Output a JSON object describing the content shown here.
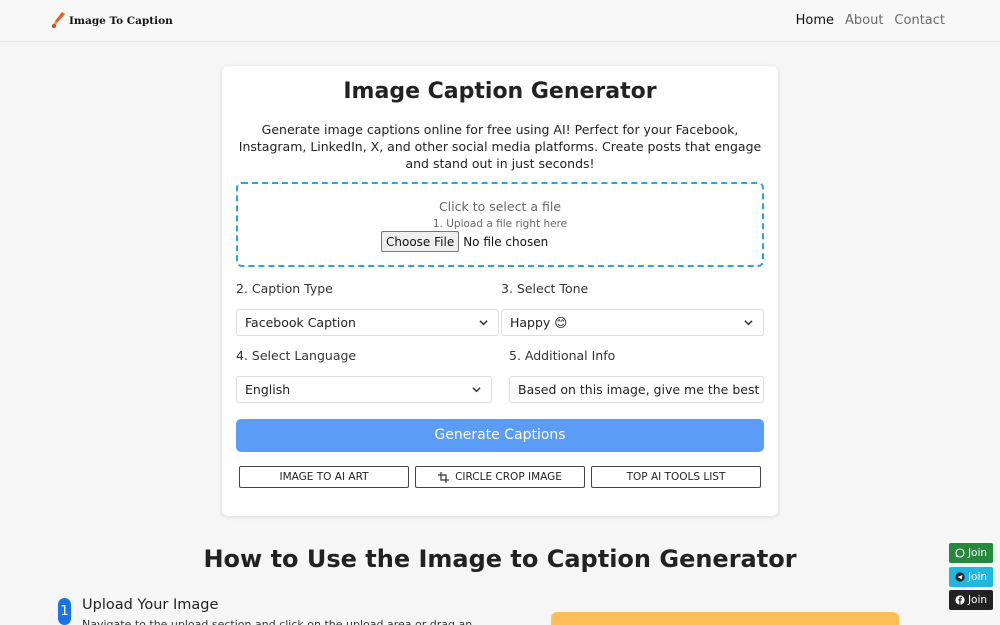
{
  "header": {
    "brand": "Image To Caption",
    "nav": [
      "Home",
      "About",
      "Contact"
    ]
  },
  "card": {
    "title": "Image Caption Generator",
    "description": "Generate image captions online for free using AI! Perfect for your Facebook, Instagram, LinkedIn, X, and other social media platforms. Create posts that engage and stand out in just seconds!",
    "upload": {
      "title": "Click to select a file",
      "subtitle": "1. Upload a file right here",
      "button": "Choose File",
      "status": "No file chosen"
    },
    "caption_type": {
      "label": "2. Caption Type",
      "value": "Facebook Caption"
    },
    "tone": {
      "label": "3. Select Tone",
      "value": "Happy 😊"
    },
    "language": {
      "label": "4. Select Language",
      "value": "English"
    },
    "additional": {
      "label": "5. Additional Info",
      "value": "Based on this image, give me the best cap"
    },
    "generate_button": "Generate Captions",
    "links": [
      "IMAGE TO AI ART",
      "CIRCLE CROP IMAGE",
      "TOP AI TOOLS LIST"
    ]
  },
  "how_to": {
    "title": "How to Use the Image to Caption Generator",
    "step_number": "1",
    "step_title": "Upload Your Image",
    "step_text": "Navigate to the upload section and click on the upload area or drag an image into it"
  },
  "join_buttons": [
    {
      "label": "Join",
      "icon": "whatsapp-icon",
      "color": "#25883c"
    },
    {
      "label": "Join",
      "icon": "telegram-icon",
      "color": "#1fb6e0"
    },
    {
      "label": "Join",
      "icon": "facebook-icon",
      "color": "#222222"
    }
  ]
}
